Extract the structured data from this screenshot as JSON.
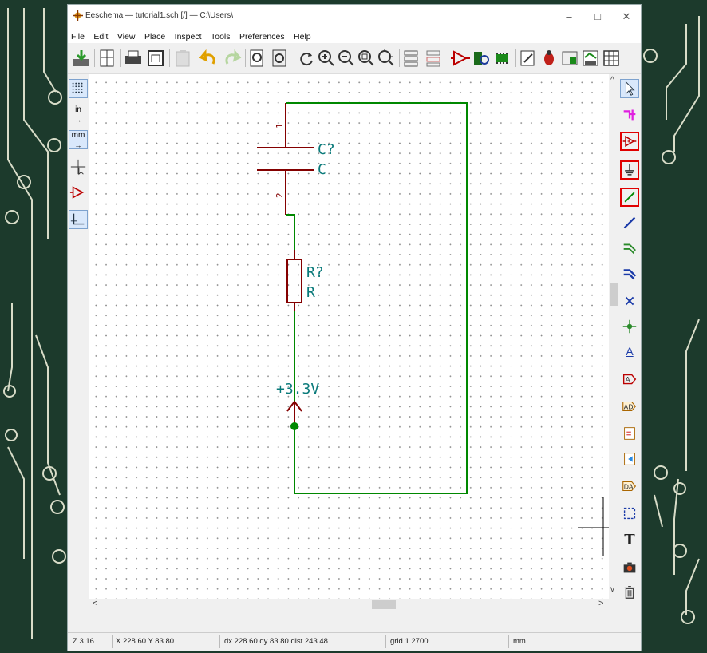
{
  "window": {
    "title": "Eeschema — tutorial1.sch [/] — C:\\Users\\",
    "minimize": "–",
    "maximize": "□",
    "close": "✕"
  },
  "menu": [
    "File",
    "Edit",
    "View",
    "Place",
    "Inspect",
    "Tools",
    "Preferences",
    "Help"
  ],
  "left_toolbar": {
    "units_in": "in",
    "units_mm": "mm"
  },
  "schematic": {
    "capacitor_ref": "C?",
    "capacitor_value": "C",
    "pin1": "1",
    "pin2": "2",
    "resistor_ref": "R?",
    "resistor_value": "R",
    "power_label": "+3.3V"
  },
  "right_toolbar": {
    "label_text": "A",
    "text_tool": "T",
    "hl_color": "#e00000"
  },
  "scroll": {
    "left_arrow": "<",
    "right_arrow": ">",
    "up_arrow": "^",
    "down_arrow": "v"
  },
  "status": {
    "zoom": "Z 3.16",
    "position": "X 228.60  Y 83.80",
    "delta": "dx 228.60  dy 83.80  dist 243.48",
    "grid": "grid 1.2700",
    "units": "mm"
  },
  "colors": {
    "wire": "#008800",
    "component": "#840000",
    "label": "#0a7a7a",
    "selection_box": "#e00000"
  }
}
